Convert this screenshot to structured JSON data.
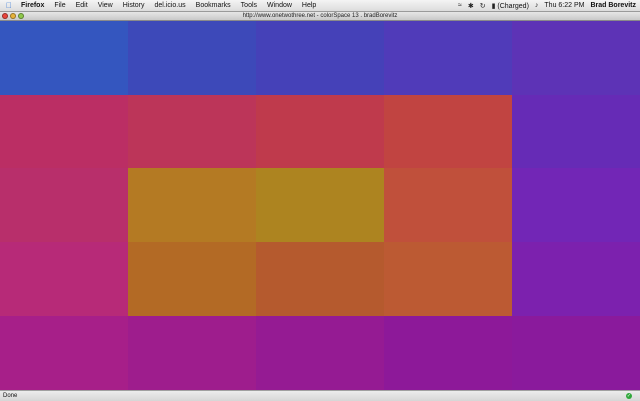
{
  "menubar": {
    "app": "Firefox",
    "items": [
      "File",
      "Edit",
      "View",
      "History",
      "del.icio.us",
      "Bookmarks",
      "Tools",
      "Window",
      "Help"
    ],
    "status": {
      "battery": "(Charged)",
      "clock": "Thu 6:22 PM",
      "user": "Brad Borevitz"
    }
  },
  "window": {
    "title": "http://www.onetwothree.net - colorSpace 13 . bradBorevitz"
  },
  "grid": {
    "cols": 5,
    "rows": 5,
    "colors": [
      [
        "#3456bf",
        "#3d49b9",
        "#4541b8",
        "#503bb9",
        "#5d33b6"
      ],
      [
        "#bb2e64",
        "#bc3559",
        "#bf3a4c",
        "#c14441",
        "#662bb6"
      ],
      [
        "#b82f6b",
        "#b47a23",
        "#ad8420",
        "#c0503b",
        "#7226b6"
      ],
      [
        "#b72a78",
        "#b36a25",
        "#b55a2e",
        "#bc5a33",
        "#7c21ae"
      ],
      [
        "#a71f89",
        "#9e1d8d",
        "#951b93",
        "#8d1999",
        "#8a1a9c"
      ]
    ]
  },
  "statusbar": {
    "text": "Done",
    "secure_color": "#2fa83a"
  }
}
